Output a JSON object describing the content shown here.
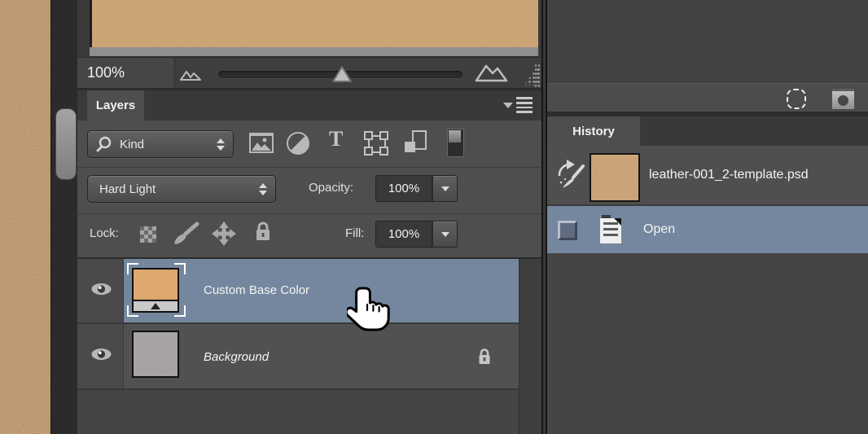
{
  "colors": {
    "selection_highlight": "#75879E",
    "leather_orange": "#D7A066",
    "panel_gray": "#4E4E4E",
    "header_gray": "#393939"
  },
  "navigator": {
    "zoom_value": "100%"
  },
  "layers_panel": {
    "tab_label": "Layers",
    "kind_filter_label": "Kind",
    "blend_mode": "Hard Light",
    "opacity_label": "Opacity:",
    "opacity_value": "100%",
    "lock_label": "Lock:",
    "fill_label": "Fill:",
    "fill_value": "100%",
    "layers": [
      {
        "name": "Custom Base Color",
        "selected": true,
        "visible": true,
        "type": "fill-layer"
      },
      {
        "name": "Background",
        "selected": false,
        "visible": true,
        "locked": true,
        "type": "image-layer"
      }
    ]
  },
  "history_panel": {
    "tab_label": "History",
    "snapshot_name": "leather-001_2-template.psd",
    "states": [
      {
        "label": "Open",
        "selected": true
      }
    ]
  },
  "icons": {
    "search": "magnifier",
    "filter_pixel_layers": "image-frame",
    "filter_adjustment_layers": "half-filled-circle",
    "filter_type_layers": "letter-T",
    "filter_shape_layers": "square-with-corner-handles",
    "filter_smart_objects": "page-with-square",
    "filter_toggle": "switch",
    "lock_transparent": "checkerboard",
    "lock_pixels": "paintbrush",
    "lock_position": "four-way-arrows",
    "lock_all": "padlock",
    "visibility": "eye",
    "panel_menu": "triangle-with-lines",
    "navigator_zoom_out": "small-mountains",
    "navigator_zoom_in": "large-mountains",
    "history_brush_source": "brush-with-arrow",
    "history_state_document": "document-lines",
    "selection_tool": "dashed-ellipse",
    "mask_button": "dark-circle",
    "cursor": "pointing-hand"
  }
}
